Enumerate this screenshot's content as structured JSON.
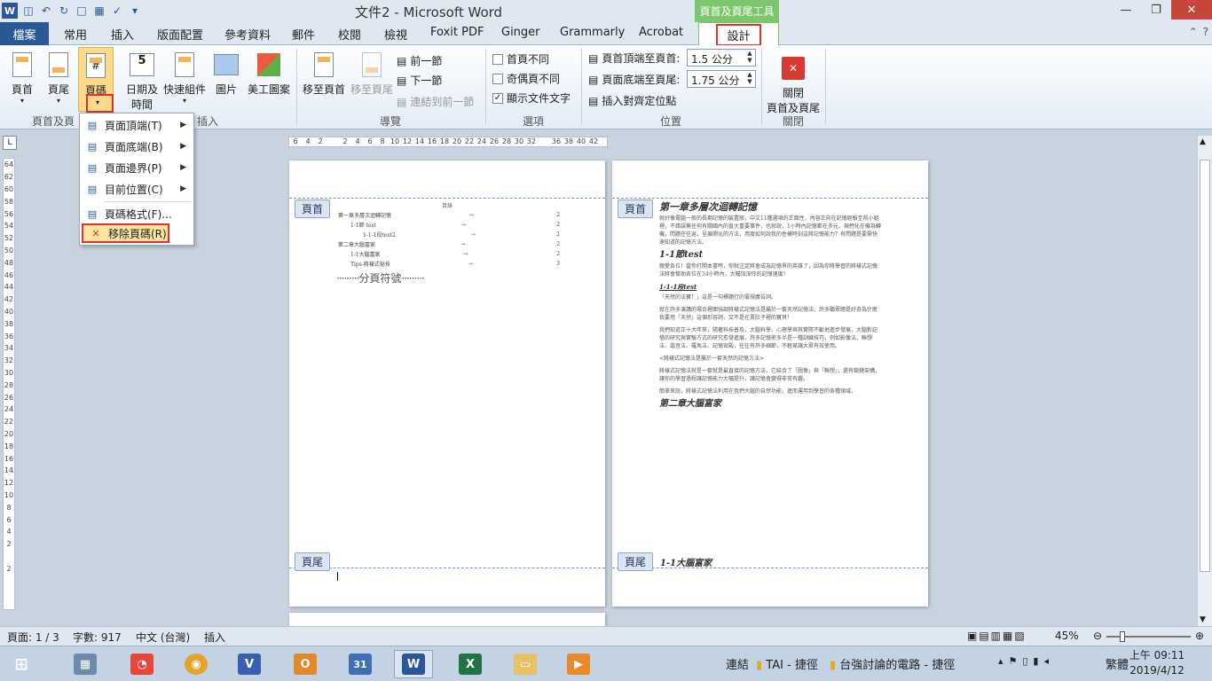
{
  "window": {
    "title": "文件2 - Microsoft Word",
    "context_tab_title": "頁首及頁尾工具",
    "word_icon": "W"
  },
  "tabs": [
    "檔案",
    "常用",
    "插入",
    "版面配置",
    "參考資料",
    "郵件",
    "校閱",
    "檢視",
    "Foxit PDF",
    "Ginger",
    "Grammarly",
    "Acrobat"
  ],
  "design_tab": "設計",
  "ribbon": {
    "header": "頁首",
    "footer": "頁尾",
    "page_number": "頁碼",
    "date_time_1": "日期及",
    "date_time_2": "時間",
    "quick_parts": "快速組件",
    "picture": "圖片",
    "clip_art": "美工圖案",
    "goto_header": "移至頁首",
    "goto_footer": "移至頁尾",
    "prev_section": "前一節",
    "next_section": "下一節",
    "link_prev": "連結到前一節",
    "diff_first": "首頁不同",
    "diff_odd_even": "奇偶頁不同",
    "show_doc_text": "顯示文件文字",
    "header_from_top": "頁首頂端至頁首:",
    "header_from_top_value": "1.5 公分",
    "footer_from_bottom": "頁面底端至頁尾:",
    "footer_from_bottom_value": "1.75 公分",
    "insert_align_tab": "插入對齊定位點",
    "close_1": "關閉",
    "close_2": "頁首及頁尾",
    "groups": {
      "header_footer": "頁首及頁",
      "insert": "插入",
      "navigation": "導覽",
      "options": "選項",
      "position": "位置",
      "close": "關閉"
    }
  },
  "page_number_menu": [
    {
      "label": "頁面頂端(T)",
      "submenu": true
    },
    {
      "label": "頁面底端(B)",
      "submenu": true
    },
    {
      "label": "頁面邊界(P)",
      "submenu": true
    },
    {
      "label": "目前位置(C)",
      "submenu": true
    },
    {
      "label": "頁碼格式(F)...",
      "submenu": false
    },
    {
      "label": "移除頁碼(R)",
      "submenu": false
    }
  ],
  "ruler_ticks": [
    "6",
    "4",
    "2",
    "",
    "2",
    "4",
    "6",
    "8",
    "10",
    "12",
    "14",
    "16",
    "18",
    "20",
    "22",
    "24",
    "26",
    "28",
    "30",
    "32",
    "",
    "36",
    "38",
    "40",
    "42"
  ],
  "vruler_ticks": [
    "64",
    "62",
    "60",
    "58",
    "56",
    "54",
    "52",
    "50",
    "48",
    "46",
    "44",
    "42",
    "40",
    "38",
    "36",
    "34",
    "32",
    "30",
    "28",
    "26",
    "24",
    "22",
    "20",
    "18",
    "16",
    "14",
    "12",
    "10",
    "8",
    "6",
    "4",
    "2",
    "",
    "2",
    ""
  ],
  "page1": {
    "header_tag": "頁首",
    "footer_tag": "頁尾",
    "toc_label": "目錄",
    "toc": [
      {
        "text": "第一章多層次迴轉記憶",
        "indent": 0,
        "page": "2"
      },
      {
        "text": "1-1節 test",
        "indent": 14,
        "page": "2"
      },
      {
        "text": "1-1-1段test2",
        "indent": 28,
        "page": "2"
      },
      {
        "text": "第二章大腦富家",
        "indent": 0,
        "page": "2"
      },
      {
        "text": "1-1大腦富家",
        "indent": 14,
        "page": "2"
      },
      {
        "text": "Tips-將樣式秘技",
        "indent": 14,
        "page": "3"
      }
    ],
    "page_break": "分頁符號"
  },
  "page2": {
    "header_tag": "頁首",
    "footer_tag": "頁尾",
    "heading1": "第一章多層次迴轉記憶",
    "para1": "就好像電腦一般的長期記憶的裝置般，中文11種選項的正面性，內容正向在記憶經驗至前小組裡，不錯誤無任何有關國內的直大重要事件，也就說，1小時內記憶都在多元，現們化在機為轉機，問題在往返，呈展開化的方法，用度如何說我的性模時刻這將記憶能力？有問題是要需快速知道的記憶方法。",
    "heading2": "1-1節test",
    "para2": "親愛各位！當你打開本書時，你就注定將會成為記憶界的英雄了，因為你將學習的將樣式記憶法將會幫助各位在34小時內，大幅加深你的記憶速度！",
    "heading3": "1-1-1段test",
    "para3": "「天然的法寶！」這是一句標題行的電視廣告詞。",
    "para4": "就在許多演講的場合裡面強調將樣式記憶法是屬於一套天然記憶法，許多聽眾總是好奇為什麼我要用「天然」這個形容詞，又不是在賣肚子裡的寶貝！",
    "para5": "我們知道正十大年來，隨著科技普及，大腦科學、心理學與其實際不斷地進步發展，大腦對記憶的研究與實驗方式的研究愈發進展，許多記憶術多半是一種訓練技巧，例如影像法、聯想法、諧音法、羅馬法、記憶宮殿，往往有許多細節，不輕易讓大眾有效使用。",
    "para6": "<將樣式記憶法是屬於一套天然的記憶方法>",
    "para7": "將樣式記憶法就是一套就是最直接的記憶方法，它結合了「圖像」與「聯想」，還有鎖鏈架構，讓你的學習過程讓記憶能力大幅提升，讓記憶會變得非常有趣。",
    "para8": "簡單來說，將樣式記憶法利用在我們大腦的自然功能，進而運用到學習的各種領域。",
    "heading4": "第二章大腦富家",
    "heading5": "1-1大腦富家"
  },
  "statusbar": {
    "page": "頁面: 1 / 3",
    "words": "字數: 917",
    "language": "中文 (台灣)",
    "mode": "插入",
    "zoom": "45%",
    "zoom_fraction": 0.45
  },
  "taskbar": {
    "links_label": "連結",
    "bookmark1": "TAI - 捷徑",
    "bookmark2": "台強討論的電路 - 捷徑",
    "ime": "繁體",
    "time": "上午 09:11",
    "date": "2019/4/12"
  }
}
